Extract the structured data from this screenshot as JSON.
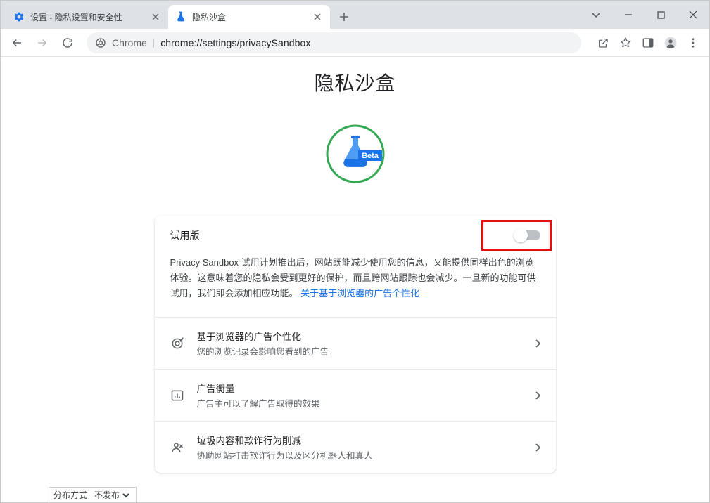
{
  "tabs": {
    "tab1_title": "设置 - 隐私设置和安全性",
    "tab2_title": "隐私沙盒"
  },
  "omnibox": {
    "chrome_label": "Chrome",
    "url_path": "chrome://settings/privacySandbox"
  },
  "page": {
    "title": "隐私沙盒",
    "beta_badge": "Beta",
    "trial_label": "试用版",
    "trial_desc_1": "Privacy Sandbox 试用计划推出后，网站既能减少使用您的信息，又能提供同样出色的浏览体验。这意味着您的隐私会受到更好的保护，而且跨网站跟踪也会减少。一旦新的功能可供试用，我们即会添加相应功能。",
    "trial_link": "关于基于浏览器的广告个性化",
    "items": [
      {
        "title": "基于浏览器的广告个性化",
        "sub": "您的浏览记录会影响您看到的广告"
      },
      {
        "title": "广告衡量",
        "sub": "广告主可以了解广告取得的效果"
      },
      {
        "title": "垃圾内容和欺诈行为削减",
        "sub": "协助网站打击欺诈行为以及区分机器人和真人"
      }
    ]
  },
  "footer": {
    "label": "分布方式",
    "option": "不发布"
  }
}
